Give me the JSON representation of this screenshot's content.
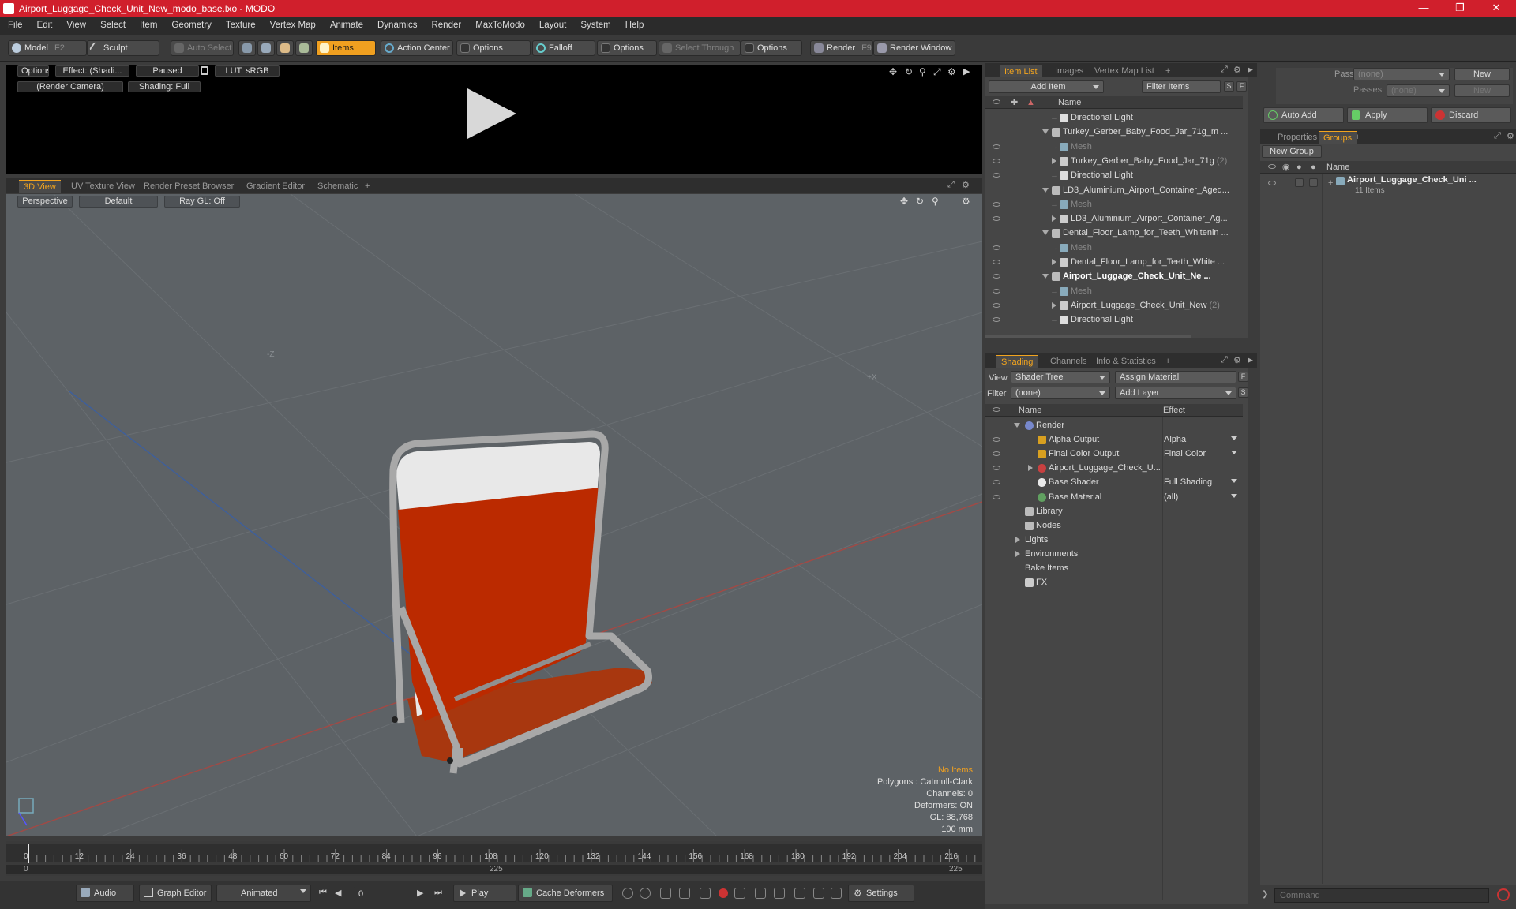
{
  "titlebar": {
    "title": "Airport_Luggage_Check_Unit_New_modo_base.lxo - MODO"
  },
  "menu": [
    "File",
    "Edit",
    "View",
    "Select",
    "Item",
    "Geometry",
    "Texture",
    "Vertex Map",
    "Animate",
    "Dynamics",
    "Render",
    "MaxToModo",
    "Layout",
    "System",
    "Help"
  ],
  "toolbar": {
    "model": "Model",
    "model_key": "F2",
    "sculpt": "Sculpt",
    "auto_select": "Auto Select",
    "items": "Items",
    "action_center": "Action Center",
    "options1": "Options",
    "falloff": "Falloff",
    "options2": "Options",
    "select_through": "Select Through",
    "options3": "Options",
    "render": "Render",
    "render_key": "F9",
    "render_window": "Render Window"
  },
  "preview": {
    "options": "Options",
    "effect": "Effect: (Shadi...",
    "paused": "Paused",
    "lut": "LUT: sRGB",
    "camera": "(Render Camera)",
    "shading": "Shading: Full"
  },
  "viewport_tabs": [
    "3D View",
    "UV Texture View",
    "Render Preset Browser",
    "Gradient Editor",
    "Schematic"
  ],
  "viewport": {
    "perspective": "Perspective",
    "default": "Default",
    "raygl": "Ray GL: Off",
    "stats": [
      "No Items",
      "Polygons : Catmull-Clark",
      "Channels: 0",
      "Deformers: ON",
      "GL: 88,768",
      "100 mm"
    ],
    "colors": {
      "body": "#bb2a00",
      "top": "#e8e8e8",
      "frame": "#a8a8a8",
      "stats_accent": "#f0a020"
    }
  },
  "timeline": {
    "ticks": [
      "0",
      "12",
      "24",
      "36",
      "48",
      "60",
      "72",
      "84",
      "96",
      "108",
      "120",
      "132",
      "144",
      "156",
      "168",
      "180",
      "192",
      "204",
      "216"
    ],
    "start": "0",
    "mid": "225",
    "end": "225"
  },
  "bottombar": {
    "audio": "Audio",
    "graph_editor": "Graph Editor",
    "animated": "Animated",
    "frame": "0",
    "play": "Play",
    "cache": "Cache Deformers",
    "settings": "Settings"
  },
  "item_list": {
    "tabs": [
      "Item List",
      "Images",
      "Vertex Map List"
    ],
    "add_item": "Add Item",
    "filter": "Filter Items",
    "s": "S",
    "f": "F",
    "col_name": "Name",
    "rows": [
      {
        "label": "Directional Light",
        "indent": 2,
        "icon": "light-icon",
        "eye": false
      },
      {
        "label": "Turkey_Gerber_Baby_Food_Jar_71g_m ...",
        "indent": 1,
        "icon": "scene-icon",
        "eye": false,
        "expand": true
      },
      {
        "label": "Mesh",
        "indent": 2,
        "icon": "mesh-icon",
        "eye": true,
        "dim": true
      },
      {
        "label": "Turkey_Gerber_Baby_Food_Jar_71g",
        "count": "(2)",
        "indent": 2,
        "icon": "locator-icon",
        "eye": true,
        "child": true
      },
      {
        "label": "Directional Light",
        "indent": 2,
        "icon": "light-icon",
        "eye": true
      },
      {
        "label": "LD3_Aluminium_Airport_Container_Aged...",
        "indent": 1,
        "icon": "scene-icon",
        "eye": false,
        "expand": true
      },
      {
        "label": "Mesh",
        "indent": 2,
        "icon": "mesh-icon",
        "eye": true,
        "dim": true
      },
      {
        "label": "LD3_Aluminium_Airport_Container_Ag...",
        "indent": 2,
        "icon": "locator-icon",
        "eye": true,
        "child": true
      },
      {
        "label": "Dental_Floor_Lamp_for_Teeth_Whitenin ...",
        "indent": 1,
        "icon": "scene-icon",
        "eye": false,
        "expand": true
      },
      {
        "label": "Mesh",
        "indent": 2,
        "icon": "mesh-icon",
        "eye": true,
        "dim": true
      },
      {
        "label": "Dental_Floor_Lamp_for_Teeth_White ...",
        "indent": 2,
        "icon": "locator-icon",
        "eye": true,
        "child": true
      },
      {
        "label": "Airport_Luggage_Check_Unit_Ne ...",
        "indent": 1,
        "icon": "scene-icon",
        "eye": true,
        "expand": true,
        "bold": true
      },
      {
        "label": "Mesh",
        "indent": 2,
        "icon": "mesh-icon",
        "eye": true,
        "dim": true
      },
      {
        "label": "Airport_Luggage_Check_Unit_New",
        "count": "(2)",
        "indent": 2,
        "icon": "locator-icon",
        "eye": true,
        "child": true
      },
      {
        "label": "Directional Light",
        "indent": 2,
        "icon": "light-icon",
        "eye": true
      }
    ]
  },
  "shading": {
    "tabs": [
      "Shading",
      "Channels",
      "Info & Statistics"
    ],
    "view_label": "View",
    "view_value": "Shader Tree",
    "assign": "Assign Material",
    "f": "F",
    "filter_label": "Filter",
    "filter_value": "(none)",
    "add_layer": "Add Layer",
    "s": "S",
    "col_name": "Name",
    "col_effect": "Effect",
    "rows": [
      {
        "label": "Render",
        "indent": 0,
        "icon": "render-icon",
        "effect": "",
        "eye": false,
        "expand": true
      },
      {
        "label": "Alpha Output",
        "indent": 1,
        "icon": "output-icon",
        "effect": "Alpha",
        "eye": true
      },
      {
        "label": "Final Color Output",
        "indent": 1,
        "icon": "output-icon",
        "effect": "Final Color",
        "eye": true
      },
      {
        "label": "Airport_Luggage_Check_U...",
        "indent": 1,
        "icon": "material-icon",
        "effect": "",
        "eye": true,
        "child": true
      },
      {
        "label": "Base Shader",
        "indent": 1,
        "icon": "shader-icon",
        "effect": "Full Shading",
        "eye": true
      },
      {
        "label": "Base Material",
        "indent": 1,
        "icon": "base-material-icon",
        "effect": "(all)",
        "eye": true
      },
      {
        "label": "Library",
        "indent": 0,
        "icon": "folder-icon",
        "effect": "",
        "eye": false
      },
      {
        "label": "Nodes",
        "indent": 0,
        "icon": "folder-icon",
        "effect": "",
        "eye": false
      },
      {
        "label": "Lights",
        "indent": 0,
        "icon": "",
        "effect": "",
        "eye": false,
        "child": true
      },
      {
        "label": "Environments",
        "indent": 0,
        "icon": "",
        "effect": "",
        "eye": false,
        "child": true
      },
      {
        "label": "Bake Items",
        "indent": 0,
        "icon": "",
        "effect": "",
        "eye": false
      },
      {
        "label": "FX",
        "indent": 0,
        "icon": "fx-icon",
        "effect": "",
        "eye": false
      }
    ]
  },
  "groups": {
    "pass_groups": "Pass Groups",
    "pass_value": "(none)",
    "new": "New",
    "passes": "Passes",
    "passes_value": "(none)",
    "new2": "New",
    "auto_add": "Auto Add",
    "apply": "Apply",
    "discard": "Discard",
    "tabs": [
      "Properties",
      "Groups"
    ],
    "new_group": "New Group",
    "col_name": "Name",
    "item_name": "Airport_Luggage_Check_Uni ...",
    "item_count": "11 Items",
    "command_placeholder": "Command"
  }
}
